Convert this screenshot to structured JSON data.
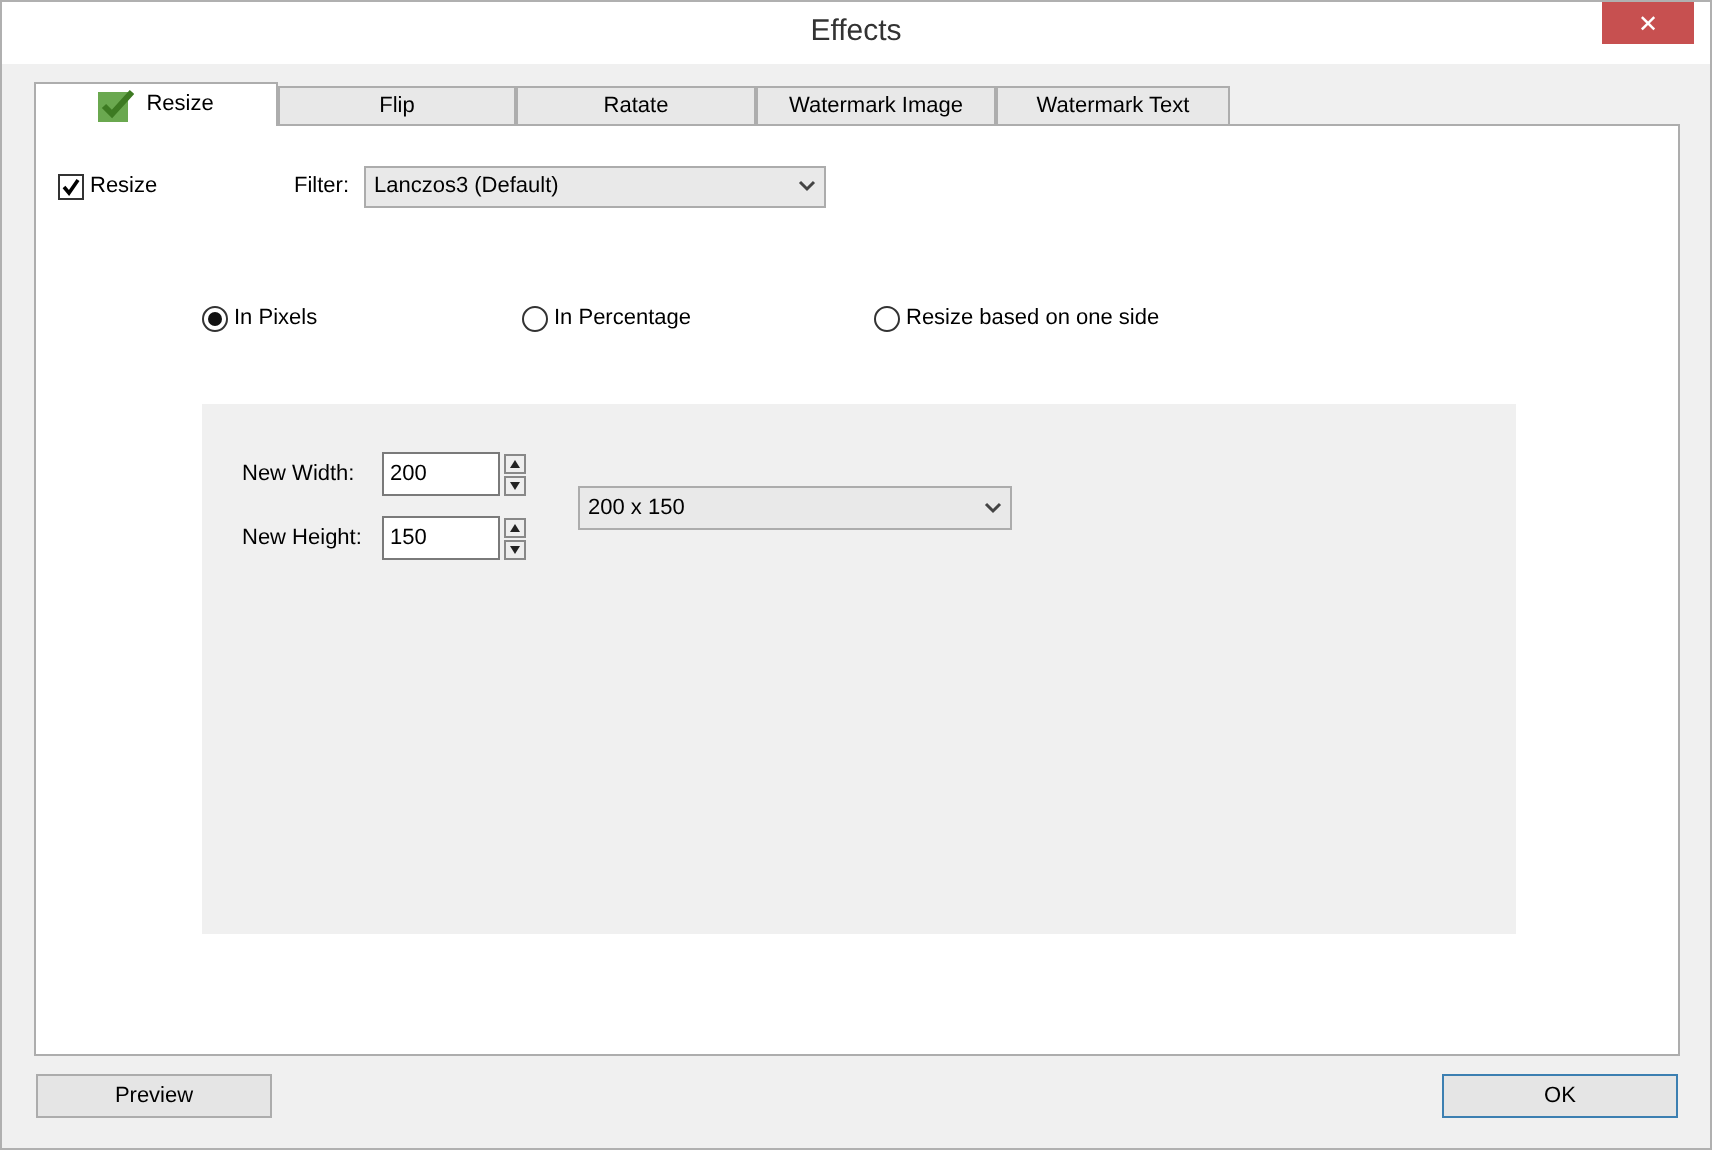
{
  "window": {
    "title": "Effects",
    "close": "✕"
  },
  "tabs": [
    {
      "label": "Resize",
      "selected": true
    },
    {
      "label": "Flip",
      "selected": false
    },
    {
      "label": "Ratate",
      "selected": false
    },
    {
      "label": "Watermark Image",
      "selected": false
    },
    {
      "label": "Watermark Text",
      "selected": false
    }
  ],
  "resize": {
    "label": "Resize",
    "checked": true
  },
  "filter": {
    "label": "Filter:",
    "value": "Lanczos3 (Default)"
  },
  "modes": [
    {
      "label": "In Pixels",
      "selected": true
    },
    {
      "label": "In Percentage",
      "selected": false
    },
    {
      "label": "Resize based on one side",
      "selected": false
    }
  ],
  "width": {
    "label": "New Width:",
    "value": "200"
  },
  "height": {
    "label": "New Height:",
    "value": "150"
  },
  "preset": {
    "value": "200 x 150"
  },
  "buttons": [
    {
      "label": "Preview"
    },
    {
      "label": "OK",
      "focused": true
    }
  ]
}
